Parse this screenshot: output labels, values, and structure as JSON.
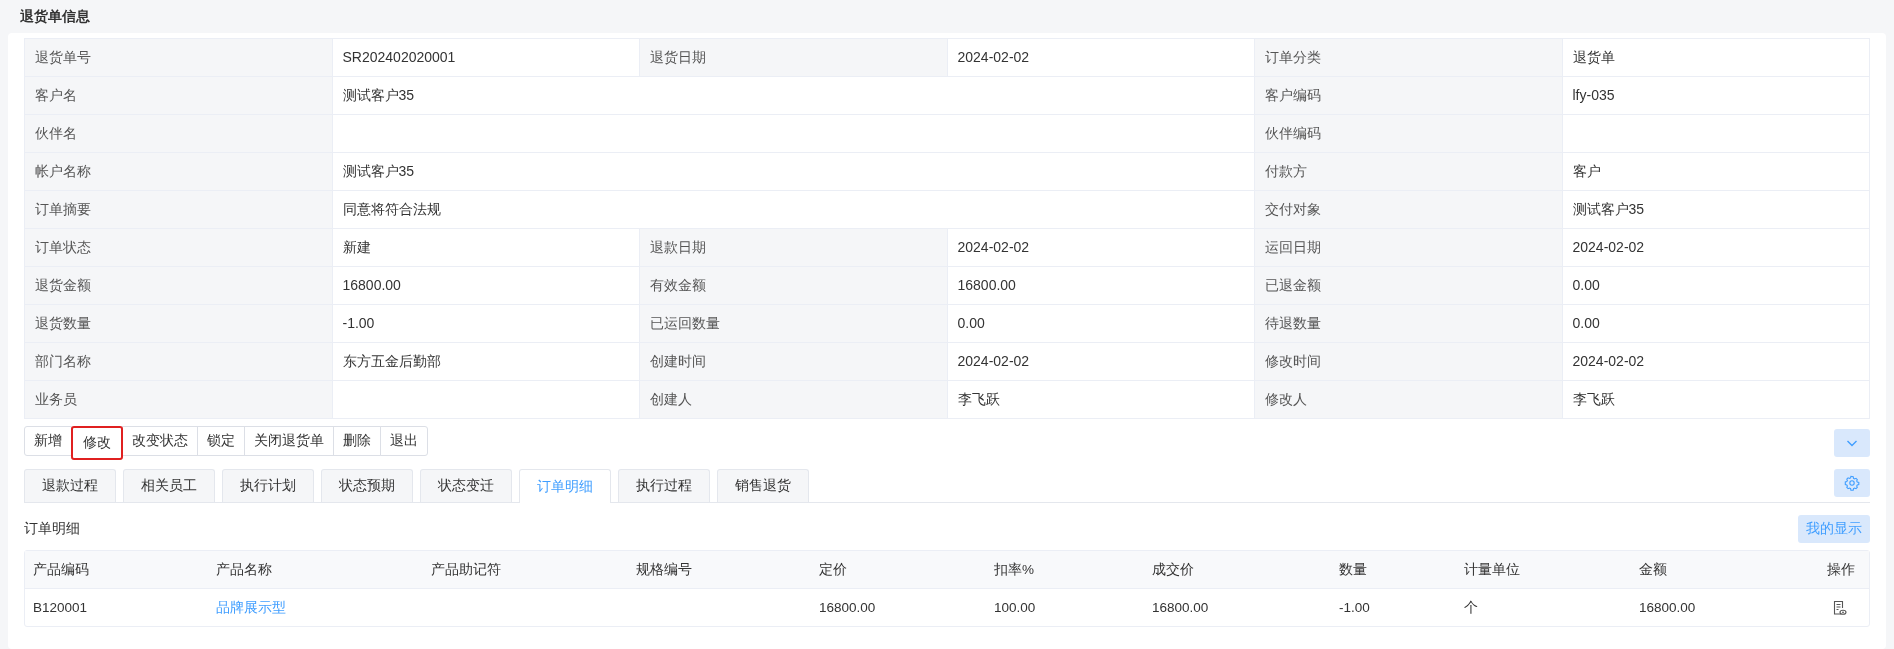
{
  "header": {
    "title": "退货单信息"
  },
  "info_rows": [
    {
      "fields": [
        {
          "label": "退货单号",
          "value": "SR202402020001"
        },
        {
          "label": "退货日期",
          "value": "2024-02-02"
        },
        {
          "label": "订单分类",
          "value": "退货单"
        }
      ]
    },
    {
      "fields": [
        {
          "label": "客户名",
          "value": "测试客户35",
          "wide": true
        },
        {
          "label": "客户编码",
          "value": "lfy-035"
        }
      ]
    },
    {
      "fields": [
        {
          "label": "伙伴名",
          "wide": true
        },
        {
          "label": "伙伴编码"
        }
      ]
    },
    {
      "fields": [
        {
          "label": "帐户名称",
          "value": "测试客户35",
          "wide": true
        },
        {
          "label": "付款方",
          "value": "客户"
        }
      ]
    },
    {
      "fields": [
        {
          "label": "订单摘要",
          "value": "同意将符合法规",
          "wide": true
        },
        {
          "label": "交付对象",
          "value": "测试客户35"
        }
      ]
    },
    {
      "fields": [
        {
          "label": "订单状态",
          "value": "新建"
        },
        {
          "label": "退款日期",
          "value": "2024-02-02"
        },
        {
          "label": "运回日期",
          "value": "2024-02-02"
        }
      ]
    },
    {
      "fields": [
        {
          "label": "退货金额",
          "value": "16800.00"
        },
        {
          "label": "有效金额",
          "value": "16800.00"
        },
        {
          "label": "已退金额",
          "value": "0.00"
        }
      ]
    },
    {
      "fields": [
        {
          "label": "退货数量",
          "value": "-1.00"
        },
        {
          "label": "已运回数量",
          "value": "0.00"
        },
        {
          "label": "待退数量",
          "value": "0.00"
        }
      ]
    },
    {
      "fields": [
        {
          "label": "部门名称",
          "value": "东方五金后勤部"
        },
        {
          "label": "创建时间",
          "value": "2024-02-02"
        },
        {
          "label": "修改时间",
          "value": "2024-02-02"
        }
      ]
    },
    {
      "fields": [
        {
          "label": "业务员"
        },
        {
          "label": "创建人",
          "value": "李飞跃"
        },
        {
          "label": "修改人",
          "value": "李飞跃"
        }
      ]
    }
  ],
  "actions": [
    {
      "label": "新增",
      "highlighted": false
    },
    {
      "label": "修改",
      "highlighted": true
    },
    {
      "label": "改变状态",
      "highlighted": false
    },
    {
      "label": "锁定",
      "highlighted": false
    },
    {
      "label": "关闭退货单",
      "highlighted": false
    },
    {
      "label": "删除",
      "highlighted": false
    },
    {
      "label": "退出",
      "highlighted": false
    }
  ],
  "tabs": [
    {
      "label": "退款过程",
      "selected": false
    },
    {
      "label": "相关员工",
      "selected": false
    },
    {
      "label": "执行计划",
      "selected": false
    },
    {
      "label": "状态预期",
      "selected": false
    },
    {
      "label": "状态变迁",
      "selected": false
    },
    {
      "label": "订单明细",
      "selected": true
    },
    {
      "label": "执行过程",
      "selected": false
    },
    {
      "label": "销售退货",
      "selected": false
    }
  ],
  "detail": {
    "title": "订单明细",
    "display_button": "我的显示",
    "table": {
      "columns": [
        "产品编码",
        "产品名称",
        "产品助记符",
        "规格编号",
        "定价",
        "扣率%",
        "成交价",
        "数量",
        "计量单位",
        "金额",
        "操作"
      ],
      "rows": [
        {
          "cells": [
            {
              "kind": "text",
              "text": "B120001"
            },
            {
              "kind": "link",
              "text": "品牌展示型"
            },
            {
              "kind": "text"
            },
            {
              "kind": "text"
            },
            {
              "kind": "text",
              "text": "16800.00"
            },
            {
              "kind": "text",
              "text": "100.00"
            },
            {
              "kind": "text",
              "text": "16800.00"
            },
            {
              "kind": "text",
              "text": "-1.00"
            },
            {
              "kind": "text",
              "text": "个"
            },
            {
              "kind": "text",
              "text": "16800.00"
            },
            {
              "kind": "action"
            }
          ]
        }
      ]
    }
  }
}
